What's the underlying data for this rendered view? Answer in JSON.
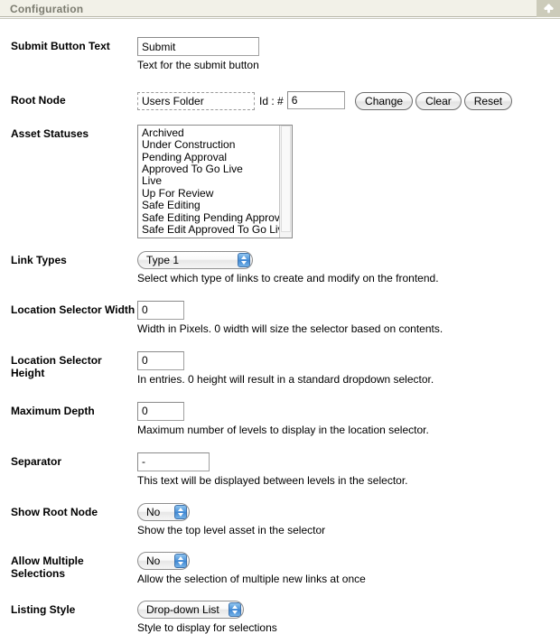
{
  "header": {
    "title": "Configuration",
    "icon": "asterisk-icon",
    "icon_bg": "#cccbba",
    "bg": "#f2f1e8",
    "title_color": "#7c7c70"
  },
  "fields": {
    "submit_button_text": {
      "label": "Submit Button Text",
      "value": "Submit",
      "placeholder": "",
      "help": "Text for the submit button"
    },
    "root_node": {
      "label": "Root Node",
      "asset_name": "Users Folder",
      "id_label": "Id : #",
      "id_value": "6",
      "buttons": [
        {
          "name": "change",
          "label": "Change"
        },
        {
          "name": "clear",
          "label": "Clear"
        },
        {
          "name": "reset",
          "label": "Reset"
        }
      ]
    },
    "asset_statuses": {
      "label": "Asset Statuses",
      "options": [
        "Archived",
        "Under Construction",
        "Pending Approval",
        "Approved To Go Live",
        "Live",
        "Up For Review",
        "Safe Editing",
        "Safe Editing Pending Approval",
        "Safe Edit Approved To Go Live"
      ]
    },
    "link_types": {
      "label": "Link Types",
      "value": "Type 1",
      "help": "Select which type of links to create and modify on the frontend."
    },
    "location_selector_width": {
      "label": "Location Selector Width",
      "value": "0",
      "help": "Width in Pixels. 0 width will size the selector based on contents."
    },
    "location_selector_height": {
      "label": "Location Selector Height",
      "value": "0",
      "help": "In entries. 0 height will result in a standard dropdown selector."
    },
    "maximum_depth": {
      "label": "Maximum Depth",
      "value": "0",
      "help": "Maximum number of levels to display in the location selector."
    },
    "separator": {
      "label": "Separator",
      "value": "-",
      "help": "This text will be displayed between levels in the selector."
    },
    "show_root_node": {
      "label": "Show Root Node",
      "value": "No",
      "help": "Show the top level asset in the selector"
    },
    "allow_multiple_selections": {
      "label": "Allow Multiple Selections",
      "value": "No",
      "help": "Allow the selection of multiple new links at once"
    },
    "listing_style": {
      "label": "Listing Style",
      "value": "Drop-down List",
      "help": "Style to display for selections"
    }
  }
}
